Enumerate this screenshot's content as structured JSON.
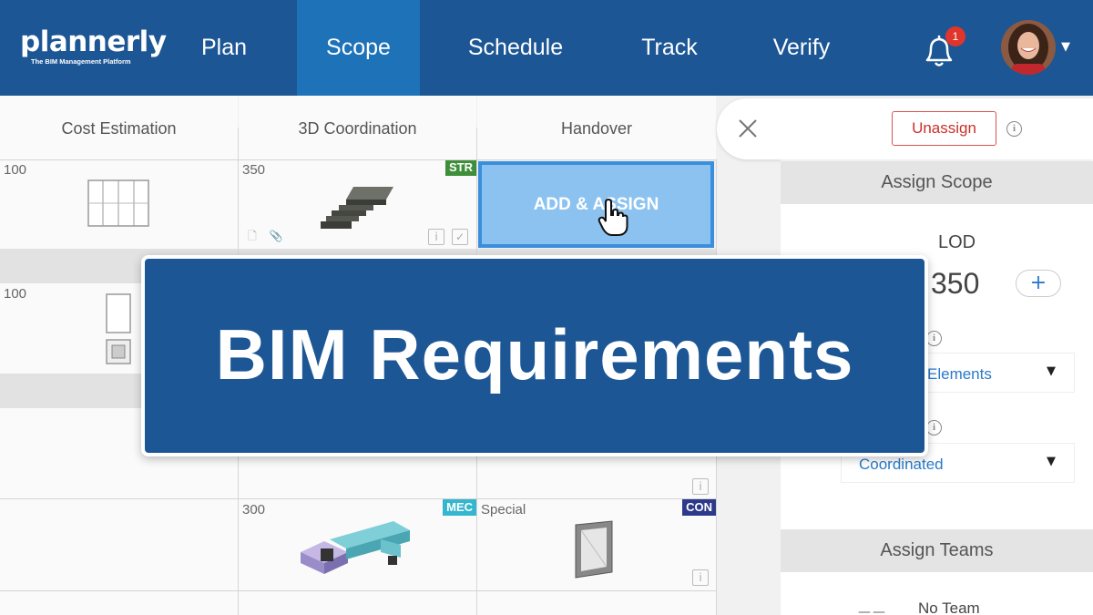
{
  "app": {
    "logo_text": "plannerly",
    "logo_tagline": "The BIM Management Platform"
  },
  "nav": {
    "items": [
      {
        "label": "Plan",
        "active": false
      },
      {
        "label": "Scope",
        "active": true
      },
      {
        "label": "Schedule",
        "active": false
      },
      {
        "label": "Track",
        "active": false
      },
      {
        "label": "Verify",
        "active": false
      }
    ],
    "notification_count": "1",
    "bell_icon": "bell-icon",
    "avatar_icon": "user-avatar",
    "brand_color": "#1c5695",
    "active_color": "#1e72b8"
  },
  "grid": {
    "columns": [
      "Cost Estimation",
      "3D Coordination",
      "Handover"
    ],
    "cells": [
      {
        "lod": "100",
        "icon": "window-frame"
      },
      {
        "lod": "350",
        "tag": "STR",
        "tag_color": "#3f8f3a",
        "icon": "stair"
      },
      {
        "add_label": "ADD & ASSIGN"
      },
      {
        "lod": "100",
        "icon": "door-and-fixture"
      },
      {
        "lod": "300",
        "tag": "MEC",
        "tag_color": "#35b6cf",
        "icon": "duct"
      },
      {
        "lod": "Special",
        "tag": "CON",
        "tag_color": "#2d3a8a",
        "icon": "frame"
      }
    ]
  },
  "panel": {
    "close_icon": "close-icon",
    "unassign_label": "Unassign",
    "assign_scope_label": "Assign Scope",
    "lod_label": "LOD",
    "lod_value": "350",
    "plus_label": "+",
    "dropdown1_value": "Elements",
    "dropdown2_value": "Coordinated",
    "assign_teams_label": "Assign Teams",
    "team_dash": "——",
    "team_value": "No Team"
  },
  "overlay": {
    "title": "BIM Requirements"
  }
}
